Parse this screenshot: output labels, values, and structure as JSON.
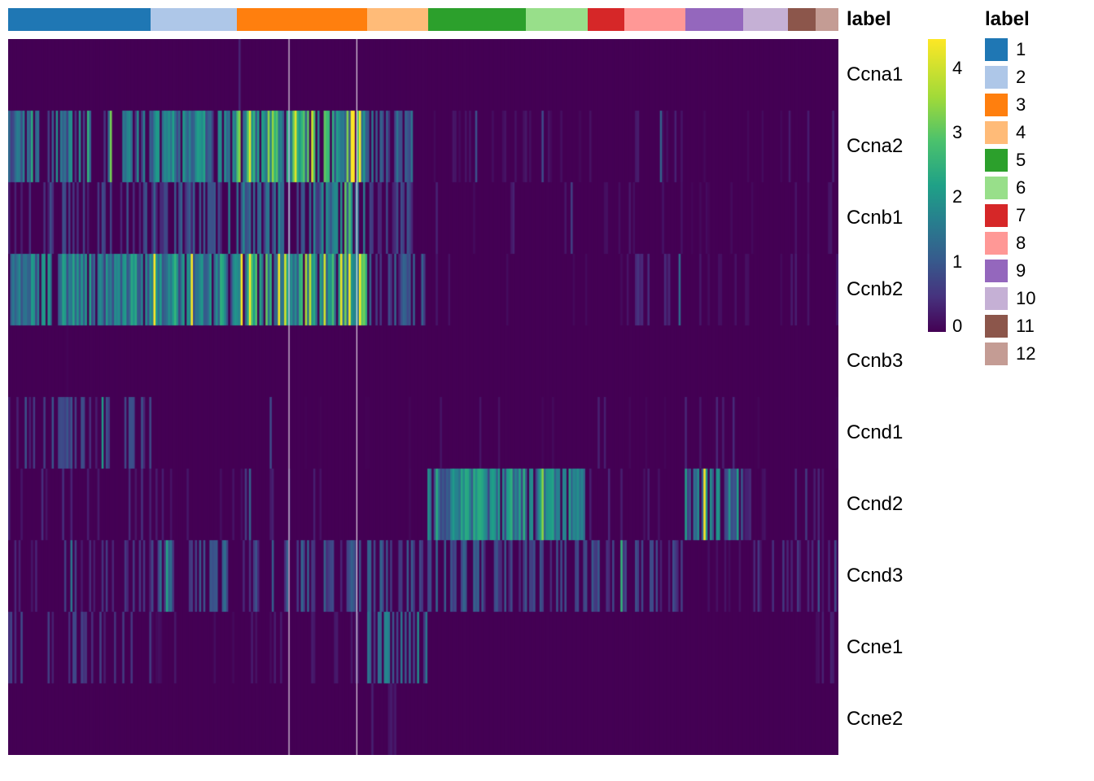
{
  "chart_data": {
    "type": "heatmap",
    "title": "",
    "row_labels": [
      "Ccna1",
      "Ccna2",
      "Ccnb1",
      "Ccnb2",
      "Ccnb3",
      "Ccnd1",
      "Ccnd2",
      "Ccnd3",
      "Ccne1",
      "Ccne2"
    ],
    "annotation": {
      "title": "label",
      "groups": [
        {
          "label": "1",
          "color": "#1f77b4",
          "width": 0.172
        },
        {
          "label": "2",
          "color": "#aec7e8",
          "width": 0.103
        },
        {
          "label": "3",
          "color": "#ff7f0e",
          "width": 0.157
        },
        {
          "label": "4",
          "color": "#ffbb78",
          "width": 0.074
        },
        {
          "label": "5",
          "color": "#2ca02c",
          "width": 0.118
        },
        {
          "label": "6",
          "color": "#98df8a",
          "width": 0.074
        },
        {
          "label": "7",
          "color": "#d62728",
          "width": 0.044
        },
        {
          "label": "8",
          "color": "#ff9896",
          "width": 0.074
        },
        {
          "label": "9",
          "color": "#9467bd",
          "width": 0.069
        },
        {
          "label": "10",
          "color": "#c5b0d5",
          "width": 0.054
        },
        {
          "label": "11",
          "color": "#8c564b",
          "width": 0.034
        },
        {
          "label": "12",
          "color": "#c49c94",
          "width": 0.027
        }
      ]
    },
    "colorbar": {
      "ticks": [
        {
          "value": "4",
          "pos": 0.1
        },
        {
          "value": "3",
          "pos": 0.32
        },
        {
          "value": "2",
          "pos": 0.54
        },
        {
          "value": "1",
          "pos": 0.76
        },
        {
          "value": "0",
          "pos": 0.98
        }
      ],
      "range": [
        0,
        4.5
      ]
    },
    "row_profiles": {
      "Ccna1": {
        "base": 0.0,
        "groups": {}
      },
      "Ccna2": {
        "base": 0.3,
        "groups": {
          "1": 1.5,
          "2": 1.8,
          "3": 2.6,
          "4": 1.2,
          "5": 0.2,
          "6": 0.2,
          "7": 0.2,
          "8": 0.3,
          "9": 0.1,
          "10": 0.1,
          "11": 0.3,
          "12": 0.3
        }
      },
      "Ccnb1": {
        "base": 0.2,
        "groups": {
          "1": 0.8,
          "2": 1.0,
          "3": 1.5,
          "4": 0.8,
          "5": 0.3,
          "6": 0.2,
          "7": 0.2,
          "8": 0.2,
          "9": 0.1,
          "10": 0.1,
          "11": 0.3,
          "12": 0.2
        }
      },
      "Ccnb2": {
        "base": 0.3,
        "groups": {
          "1": 1.8,
          "2": 2.0,
          "3": 2.8,
          "4": 1.0,
          "5": 0.2,
          "6": 0.1,
          "7": 0.1,
          "8": 0.5,
          "9": 0.2,
          "10": 0.2,
          "11": 0.4,
          "12": 0.3
        }
      },
      "Ccnb3": {
        "base": 0.0,
        "groups": {}
      },
      "Ccnd1": {
        "base": 0.1,
        "groups": {
          "1": 0.8,
          "2": 0.1,
          "3": 0.05,
          "4": 0.05,
          "5": 0.2,
          "6": 0.1,
          "7": 0.3,
          "8": 0.1,
          "9": 0.5,
          "10": 0.1,
          "11": 0.1,
          "12": 0.2
        }
      },
      "Ccnd2": {
        "base": 0.2,
        "groups": {
          "1": 0.5,
          "2": 0.3,
          "3": 0.3,
          "4": 0.2,
          "5": 2.0,
          "6": 1.8,
          "7": 0.4,
          "8": 0.3,
          "9": 1.8,
          "10": 0.4,
          "11": 0.5,
          "12": 0.4
        }
      },
      "Ccnd3": {
        "base": 0.3,
        "groups": {
          "1": 0.6,
          "2": 1.2,
          "3": 1.0,
          "4": 1.0,
          "5": 1.0,
          "6": 0.8,
          "7": 1.0,
          "8": 0.8,
          "9": 0.3,
          "10": 0.5,
          "11": 0.5,
          "12": 0.4
        }
      },
      "Ccne1": {
        "base": 0.1,
        "groups": {
          "1": 0.7,
          "2": 0.2,
          "3": 0.3,
          "4": 1.5,
          "5": 0.0,
          "6": 0.0,
          "7": 0.0,
          "8": 0.0,
          "9": 0.0,
          "10": 0.0,
          "11": 0.1,
          "12": 0.3
        }
      },
      "Ccne2": {
        "base": 0.0,
        "groups": {
          "4": 0.3
        }
      }
    }
  },
  "legend": {
    "title": "label",
    "items": [
      {
        "label": "1",
        "color": "#1f77b4"
      },
      {
        "label": "2",
        "color": "#aec7e8"
      },
      {
        "label": "3",
        "color": "#ff7f0e"
      },
      {
        "label": "4",
        "color": "#ffbb78"
      },
      {
        "label": "5",
        "color": "#2ca02c"
      },
      {
        "label": "6",
        "color": "#98df8a"
      },
      {
        "label": "7",
        "color": "#d62728"
      },
      {
        "label": "8",
        "color": "#ff9896"
      },
      {
        "label": "9",
        "color": "#9467bd"
      },
      {
        "label": "10",
        "color": "#c5b0d5"
      },
      {
        "label": "11",
        "color": "#8c564b"
      },
      {
        "label": "12",
        "color": "#c49c94"
      }
    ]
  }
}
